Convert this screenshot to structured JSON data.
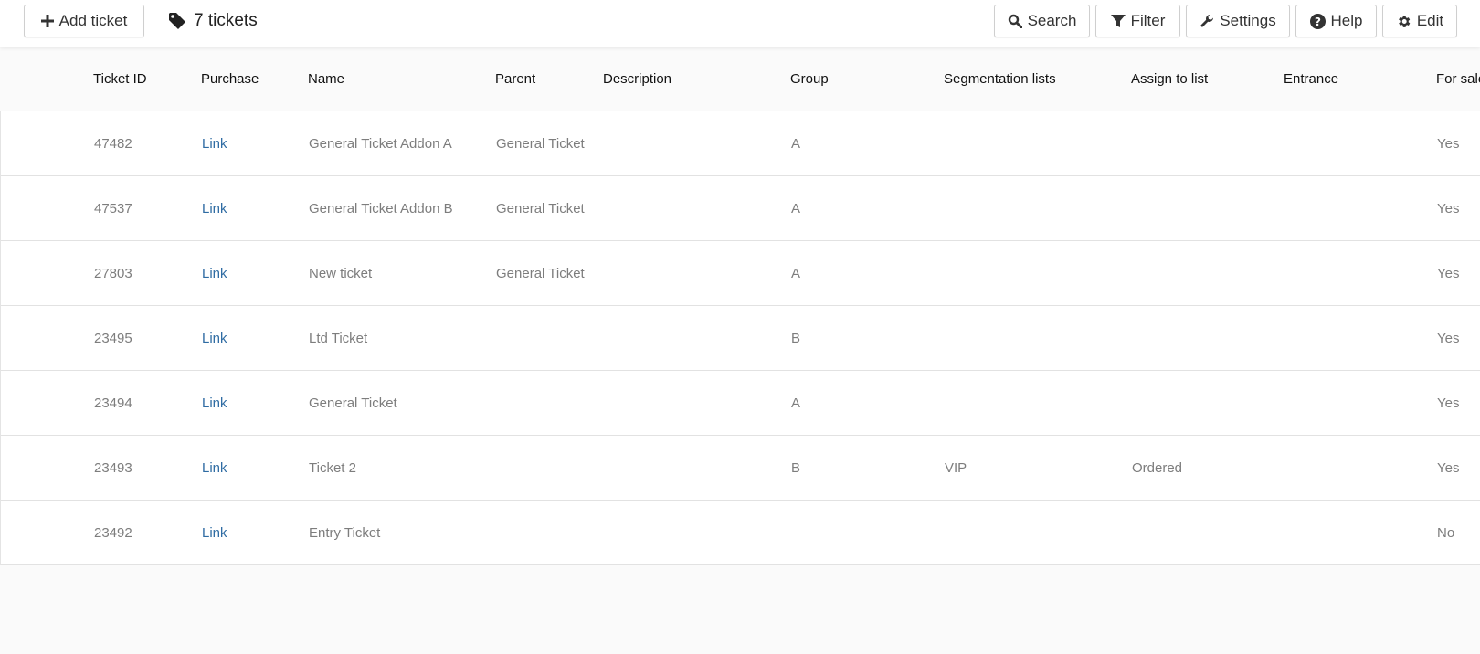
{
  "toolbar": {
    "add_label": "Add ticket",
    "count_label": "7 tickets",
    "search_label": "Search",
    "filter_label": "Filter",
    "settings_label": "Settings",
    "help_label": "Help",
    "edit_label": "Edit"
  },
  "table": {
    "columns": [
      "Ticket ID",
      "Purchase",
      "Name",
      "Parent",
      "Description",
      "Group",
      "Segmentation lists",
      "Assign to list",
      "Entrance",
      "For sale"
    ],
    "rows": [
      {
        "id": "47482",
        "purchase": "Link",
        "name": "General Ticket Addon A",
        "parent": "General Ticket",
        "description": "",
        "group": "A",
        "segmentation": "",
        "assign": "",
        "entrance": "",
        "for_sale": "Yes"
      },
      {
        "id": "47537",
        "purchase": "Link",
        "name": "General Ticket Addon B",
        "parent": "General Ticket",
        "description": "",
        "group": "A",
        "segmentation": "",
        "assign": "",
        "entrance": "",
        "for_sale": "Yes"
      },
      {
        "id": "27803",
        "purchase": "Link",
        "name": "New ticket",
        "parent": "General Ticket",
        "description": "",
        "group": "A",
        "segmentation": "",
        "assign": "",
        "entrance": "",
        "for_sale": "Yes"
      },
      {
        "id": "23495",
        "purchase": "Link",
        "name": "Ltd Ticket",
        "parent": "",
        "description": "",
        "group": "B",
        "segmentation": "",
        "assign": "",
        "entrance": "",
        "for_sale": "Yes"
      },
      {
        "id": "23494",
        "purchase": "Link",
        "name": "General Ticket",
        "parent": "",
        "description": "",
        "group": "A",
        "segmentation": "",
        "assign": "",
        "entrance": "",
        "for_sale": "Yes"
      },
      {
        "id": "23493",
        "purchase": "Link",
        "name": "Ticket 2",
        "parent": "",
        "description": "",
        "group": "B",
        "segmentation": "VIP",
        "assign": "Ordered",
        "entrance": "",
        "for_sale": "Yes"
      },
      {
        "id": "23492",
        "purchase": "Link",
        "name": "Entry Ticket",
        "parent": "",
        "description": "",
        "group": "",
        "segmentation": "",
        "assign": "",
        "entrance": "",
        "for_sale": "No"
      }
    ]
  },
  "icons": {
    "add": "plus-icon",
    "count": "tag-icon",
    "search": "search-icon",
    "filter": "filter-icon",
    "settings": "wrench-icon",
    "help": "question-circle-icon",
    "edit": "gear-icon"
  },
  "colors": {
    "link": "#2f6ca3",
    "cell_text": "#7d7d7d",
    "header_text": "#111111",
    "toolbar_bg": "#ffffff",
    "page_bg": "#fafafa"
  }
}
